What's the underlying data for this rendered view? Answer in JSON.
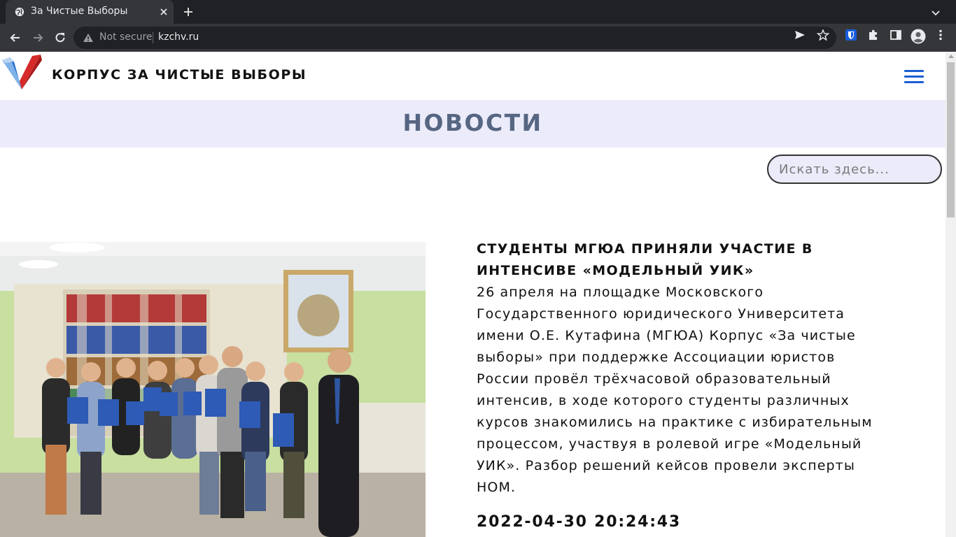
{
  "browser": {
    "tab_title": "За Чистые Выборы",
    "security_label": "Not secure",
    "url": "kzchv.ru",
    "icons": [
      "globe-icon",
      "close-icon",
      "plus-icon",
      "chevron-down-icon",
      "back-icon",
      "forward-icon",
      "reload-icon",
      "warning-icon",
      "send-icon",
      "star-icon",
      "bitwarden-icon",
      "puzzle-icon",
      "sidepanel-icon",
      "profile-icon",
      "more-icon"
    ]
  },
  "site": {
    "title": "КОРПУС ЗА ЧИСТЫЕ ВЫБОРЫ",
    "brand_colors": {
      "logo_blue": "#3a7bd5",
      "logo_red": "#d62a2a",
      "menu_blue": "#1a5fd1"
    }
  },
  "news": {
    "heading": "НОВОСТИ",
    "band_color": "#ebebfa",
    "heading_color": "#566682"
  },
  "search": {
    "placeholder": "Искать здесь..."
  },
  "article": {
    "title_lines": [
      "СТУДЕНТЫ МГЮА ПРИНЯЛИ УЧАСТИЕ В",
      "ИНТЕНСИВЕ «МОДЕЛЬНЫЙ УИК»"
    ],
    "body_lines": [
      "26 апреля на площадке Московского",
      "Государственного юридического Университета",
      "имени О.Е. Кутафина (МГЮА) Корпус «За чистые",
      "выборы» при поддержке Ассоциации юристов",
      "России провёл трёхчасовой образовательный",
      "интенсив, в ходе которого студенты различных",
      "курсов знакомились на практике с избирательным",
      "процессом, участвуя в ролевой игре «Модельный",
      "УИК». Разбор решений кейсов провели эксперты",
      "НОМ."
    ],
    "date": "2022-04-30 20:24:43"
  }
}
